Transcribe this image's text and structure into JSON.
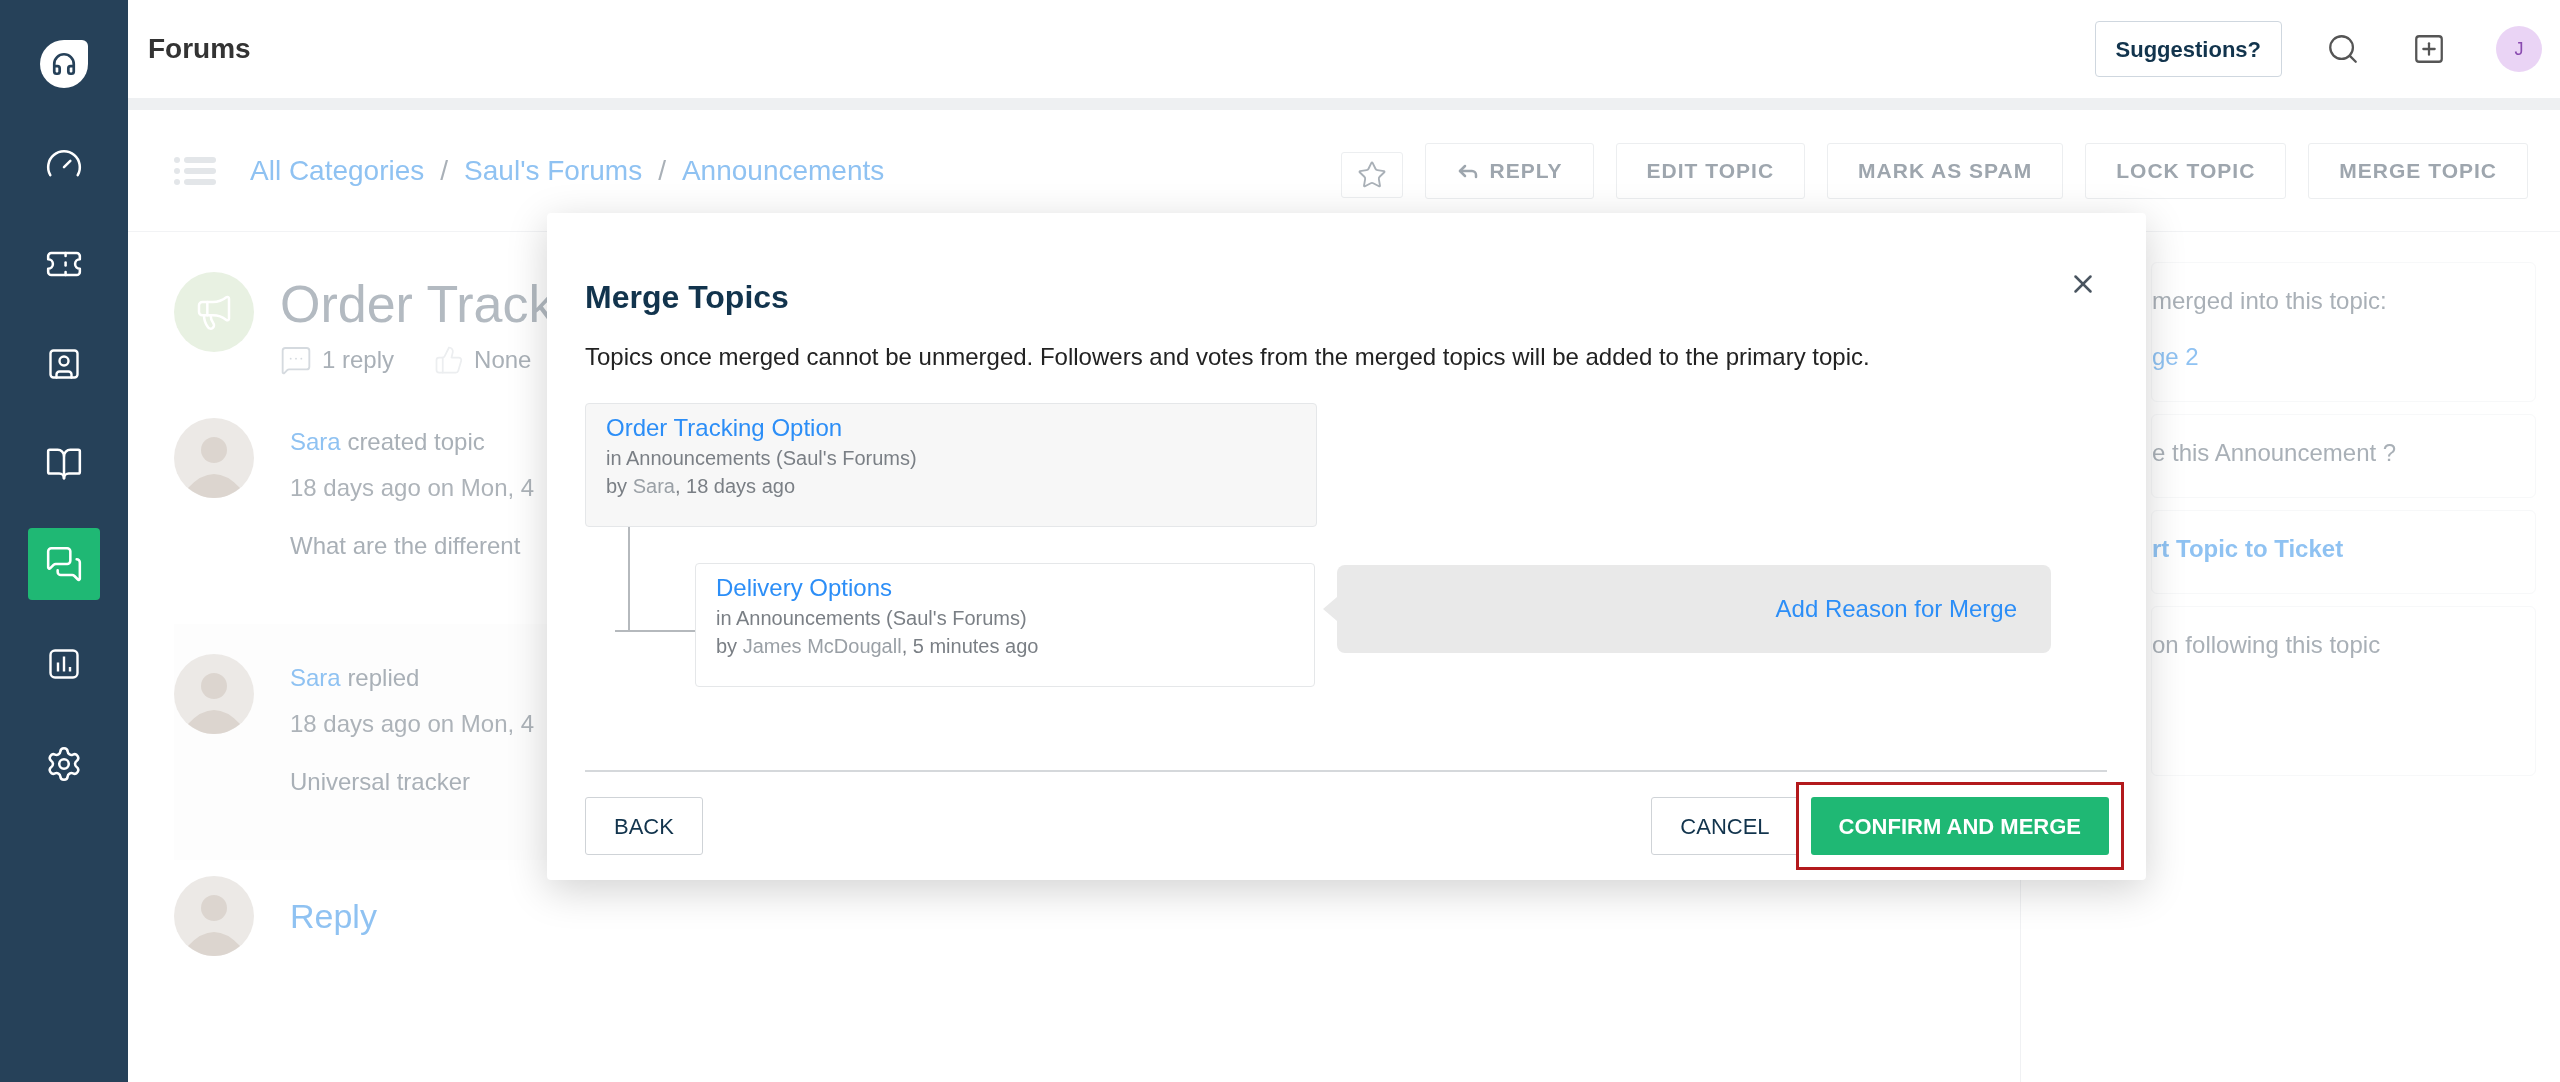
{
  "sidebar": {
    "items": [
      {
        "kind": "logo",
        "selected": false
      },
      {
        "kind": "dashboard",
        "selected": false
      },
      {
        "kind": "tickets",
        "selected": false
      },
      {
        "kind": "contacts",
        "selected": false
      },
      {
        "kind": "solutions",
        "selected": false
      },
      {
        "kind": "forums",
        "selected": true
      },
      {
        "kind": "reports",
        "selected": false
      },
      {
        "kind": "settings",
        "selected": false
      }
    ]
  },
  "header": {
    "title": "Forums",
    "suggestions_button": "Suggestions?",
    "avatar_initial": "J"
  },
  "toolbar": {
    "breadcrumbs": [
      "All Categories",
      "Saul's Forums",
      "Announcements"
    ],
    "breadcrumb_separators": [
      "/",
      "/"
    ],
    "starred": false,
    "actions": [
      {
        "kind": "reply",
        "label": "REPLY"
      },
      {
        "kind": "plain",
        "label": "EDIT TOPIC"
      },
      {
        "kind": "plain",
        "label": "MARK AS SPAM"
      },
      {
        "kind": "plain",
        "label": "LOCK TOPIC"
      },
      {
        "kind": "plain",
        "label": "MERGE TOPIC"
      }
    ]
  },
  "topic": {
    "title": "Order Track",
    "replies": "1 reply",
    "votes": "None"
  },
  "posts": [
    {
      "author": "Sara",
      "action": "created topic",
      "time": "18 days ago on Mon, 4",
      "body": "What are the different"
    },
    {
      "author": "Sara",
      "action": "replied",
      "time": "18 days ago on Mon, 4",
      "body": "Universal tracker"
    }
  ],
  "reply_prompt": "Reply",
  "right_panel": [
    {
      "lines": [
        {
          "kind": "text",
          "text": "merged into this topic:"
        },
        {
          "kind": "link",
          "text": "ge 2"
        }
      ]
    },
    {
      "lines": [
        {
          "kind": "text",
          "text": "e this Announcement ?"
        }
      ]
    },
    {
      "lines": [
        {
          "kind": "action",
          "text": "rt Topic to Ticket"
        }
      ]
    },
    {
      "lines": [
        {
          "kind": "text",
          "text": "on following this topic"
        }
      ]
    }
  ],
  "modal": {
    "title": "Merge Topics",
    "description": "Topics once merged cannot be unmerged. Followers and votes from the merged topics will be added to the primary topic.",
    "primary_topic": {
      "title": "Order Tracking Option",
      "location": "in Announcements (Saul's Forums)",
      "byline": [
        "by",
        "Sara",
        ", 18 days ago"
      ]
    },
    "merged_topics": [
      {
        "title": "Delivery Options",
        "location": "in Announcements (Saul's Forums)",
        "byline": [
          "by",
          "James McDougall",
          ", 5 minutes ago"
        ],
        "reason_link": "Add Reason for Merge"
      }
    ],
    "back_button": "BACK",
    "cancel_button": "CANCEL",
    "confirm_button": "CONFIRM AND MERGE",
    "confirm_highlighted": true
  }
}
